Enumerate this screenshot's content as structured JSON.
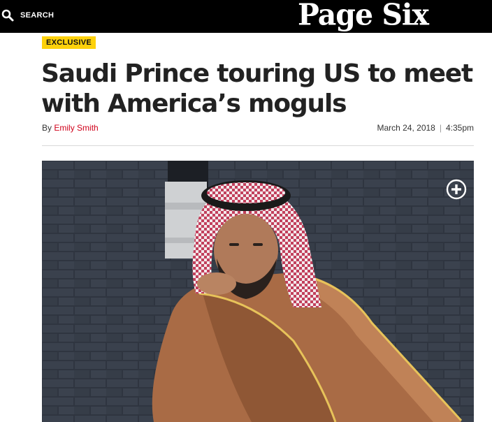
{
  "header": {
    "search_label": "SEARCH",
    "logo_text": "Page Six",
    "background": "#000000"
  },
  "article": {
    "badge": "EXCLUSIVE",
    "headline": "Saudi Prince touring US to meet with America’s moguls",
    "by_prefix": "By",
    "author": "Emily Smith",
    "date": "March 24, 2018",
    "separator": "|",
    "time": "4:35pm"
  },
  "photo": {
    "expand_icon": "plus-circle-icon"
  },
  "colors": {
    "badge": "#fdd10b",
    "author_link": "#d0021b",
    "headline": "#222222"
  }
}
